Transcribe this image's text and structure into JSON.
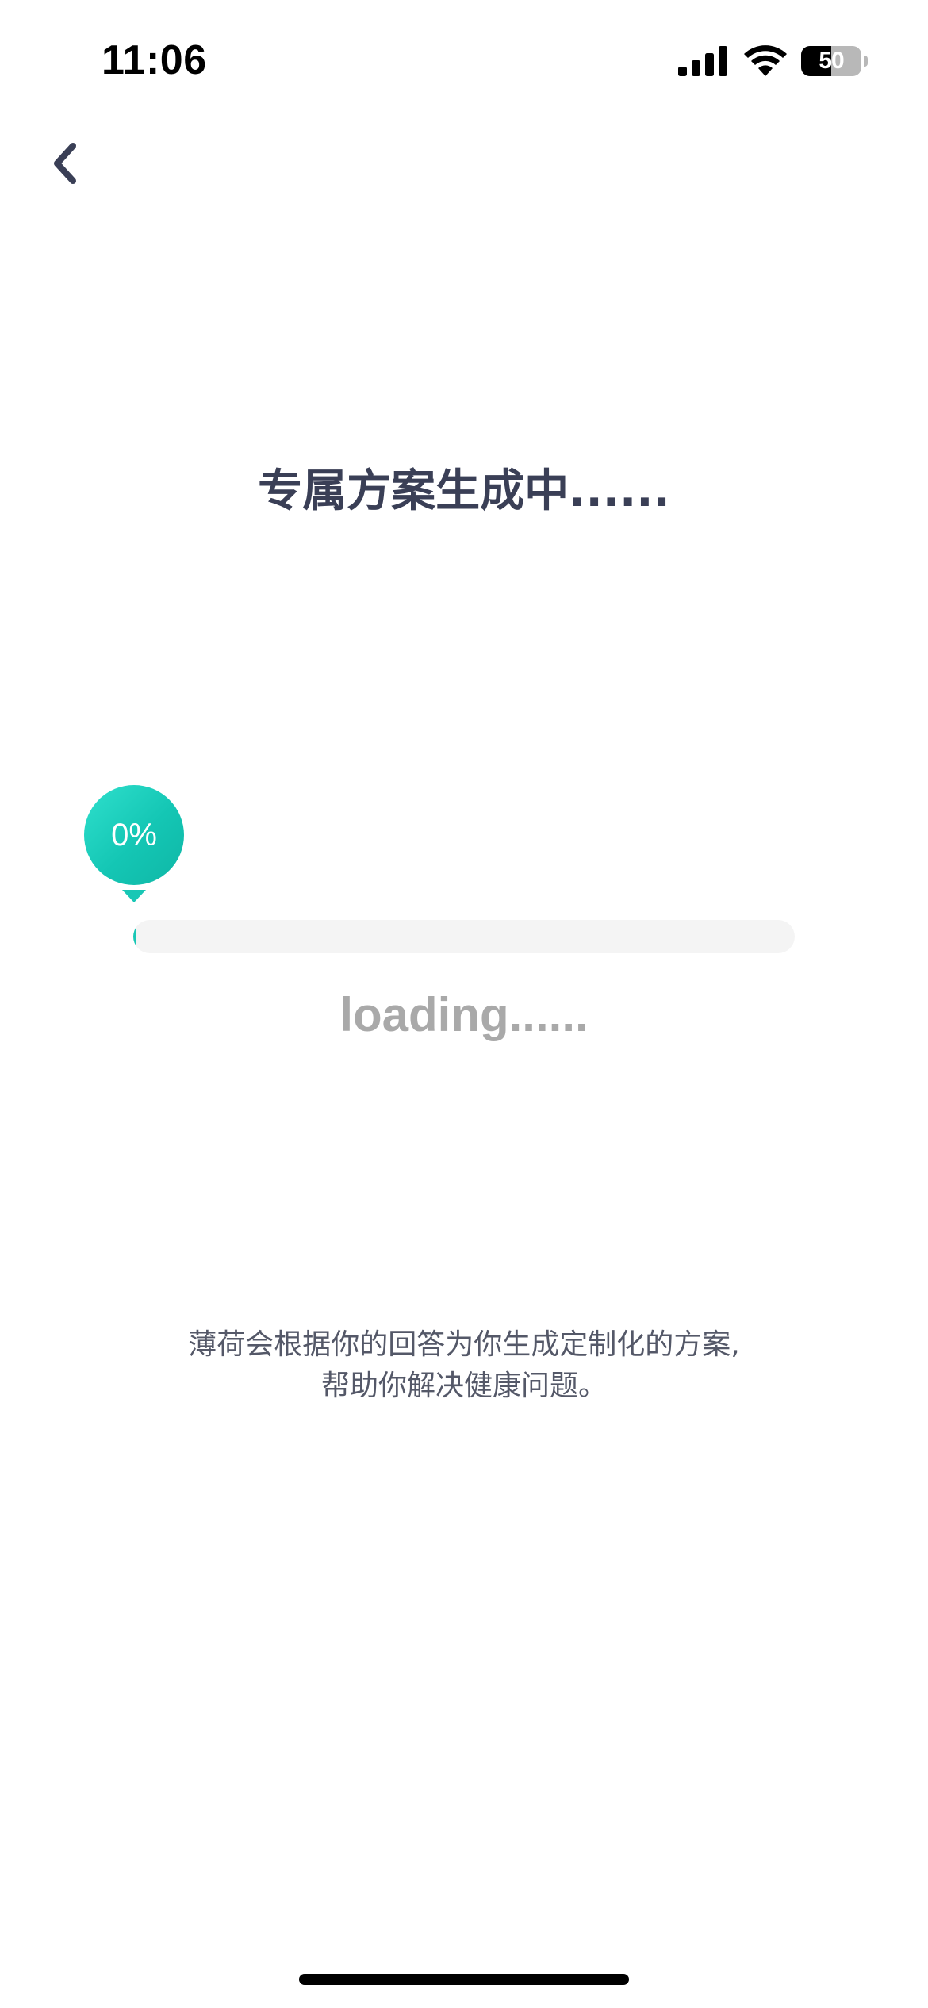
{
  "status_bar": {
    "time": "11:06",
    "battery_level": "50",
    "battery_percent": 50,
    "icons": [
      "signal-icon",
      "wifi-icon",
      "battery-icon"
    ]
  },
  "nav": {
    "back_icon": "chevron-left-icon"
  },
  "main": {
    "title": "专属方案生成中......",
    "progress": {
      "percent_label": "0%",
      "value": 0
    },
    "loading_text": "loading......",
    "description_lines": [
      "薄荷会根据你的回答为你生成定制化的方案,",
      "帮助你解决健康问题。"
    ]
  },
  "colors": {
    "accent": "#18c7b5",
    "title_text": "#3a3f56",
    "loading_text": "#a9a9a9",
    "description_text": "#545868",
    "track": "#f4f4f4"
  }
}
